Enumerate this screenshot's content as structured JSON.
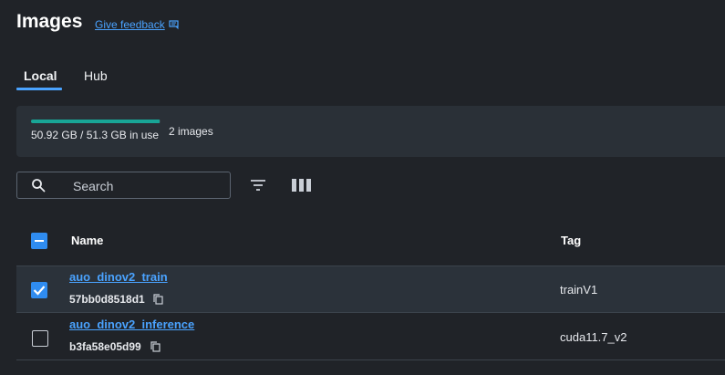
{
  "header": {
    "title": "Images",
    "feedback_label": "Give feedback"
  },
  "tabs": [
    {
      "label": "Local",
      "active": true
    },
    {
      "label": "Hub",
      "active": false
    }
  ],
  "usage": {
    "text": "50.92 GB / 51.3 GB in use",
    "count": "2 images",
    "used_fraction": 0.9926,
    "bar_color": "#18a596"
  },
  "search": {
    "placeholder": "Search",
    "value": ""
  },
  "table": {
    "columns": {
      "name": "Name",
      "tag": "Tag"
    },
    "rows": [
      {
        "name": "auo_dinov2_train",
        "id": "57bb0d8518d1",
        "tag": "trainV1",
        "selected": true
      },
      {
        "name": "auo_dinov2_inference",
        "id": "b3fa58e05d99",
        "tag": "cuda11.7_v2",
        "selected": false
      }
    ]
  },
  "colors": {
    "background": "#202328",
    "accent": "#4aa3ff",
    "checkbox": "#2f8cf0"
  }
}
